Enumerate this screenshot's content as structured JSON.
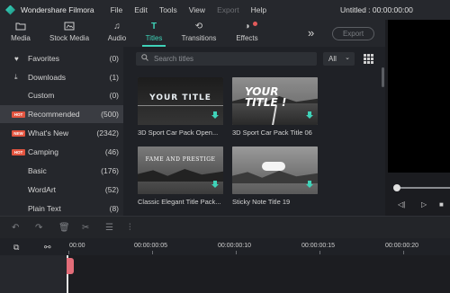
{
  "app": {
    "name": "Wondershare Filmora",
    "project_title": "Untitled : 00:00:00:00",
    "menu": [
      "File",
      "Edit",
      "Tools",
      "View",
      "Export",
      "Help"
    ]
  },
  "tabs": [
    {
      "label": "Media",
      "icon": "folder-icon"
    },
    {
      "label": "Stock Media",
      "icon": "stock-media-icon"
    },
    {
      "label": "Audio",
      "icon": "music-note-icon"
    },
    {
      "label": "Titles",
      "icon": "text-t-icon",
      "active": true
    },
    {
      "label": "Transitions",
      "icon": "transitions-icon"
    },
    {
      "label": "Effects",
      "icon": "effects-icon"
    }
  ],
  "toolbar": {
    "more_icon": "double-chevron-right-icon",
    "export_label": "Export"
  },
  "sidebar": {
    "items": [
      {
        "label": "Favorites",
        "count": "(0)",
        "icon": "heart-icon"
      },
      {
        "label": "Downloads",
        "count": "(1)",
        "icon": "download-icon"
      },
      {
        "label": "Custom",
        "count": "(0)"
      },
      {
        "label": "Recommended",
        "count": "(500)",
        "badge": "HOT",
        "active": true
      },
      {
        "label": "What's New",
        "count": "(2342)",
        "badge": "NEW"
      },
      {
        "label": "Camping",
        "count": "(46)",
        "badge": "HOT"
      },
      {
        "label": "Basic",
        "count": "(176)"
      },
      {
        "label": "WordArt",
        "count": "(52)"
      },
      {
        "label": "Plain Text",
        "count": "(8)"
      }
    ]
  },
  "search": {
    "placeholder": "Search titles",
    "filter_value": "All"
  },
  "cards": [
    {
      "title": "3D Sport Car Pack Open...",
      "thumb_text": "YOUR TITLE"
    },
    {
      "title": "3D Sport Car Pack Title 06",
      "thumb_text": "YOUR TITLE !"
    },
    {
      "title": "Classic Elegant Title Pack...",
      "thumb_text": "FAME AND PRESTIGE"
    },
    {
      "title": "Sticky Note Title 19",
      "thumb_text": ""
    }
  ],
  "timeline": {
    "timecodes": [
      "00:00",
      "00:00:00:05",
      "00:00:00:10",
      "00:00:00:15",
      "00:00:00:20"
    ]
  },
  "colors": {
    "accent": "#3fd2b8",
    "hot_badge": "#e2543f",
    "playhead": "#e36d79"
  }
}
